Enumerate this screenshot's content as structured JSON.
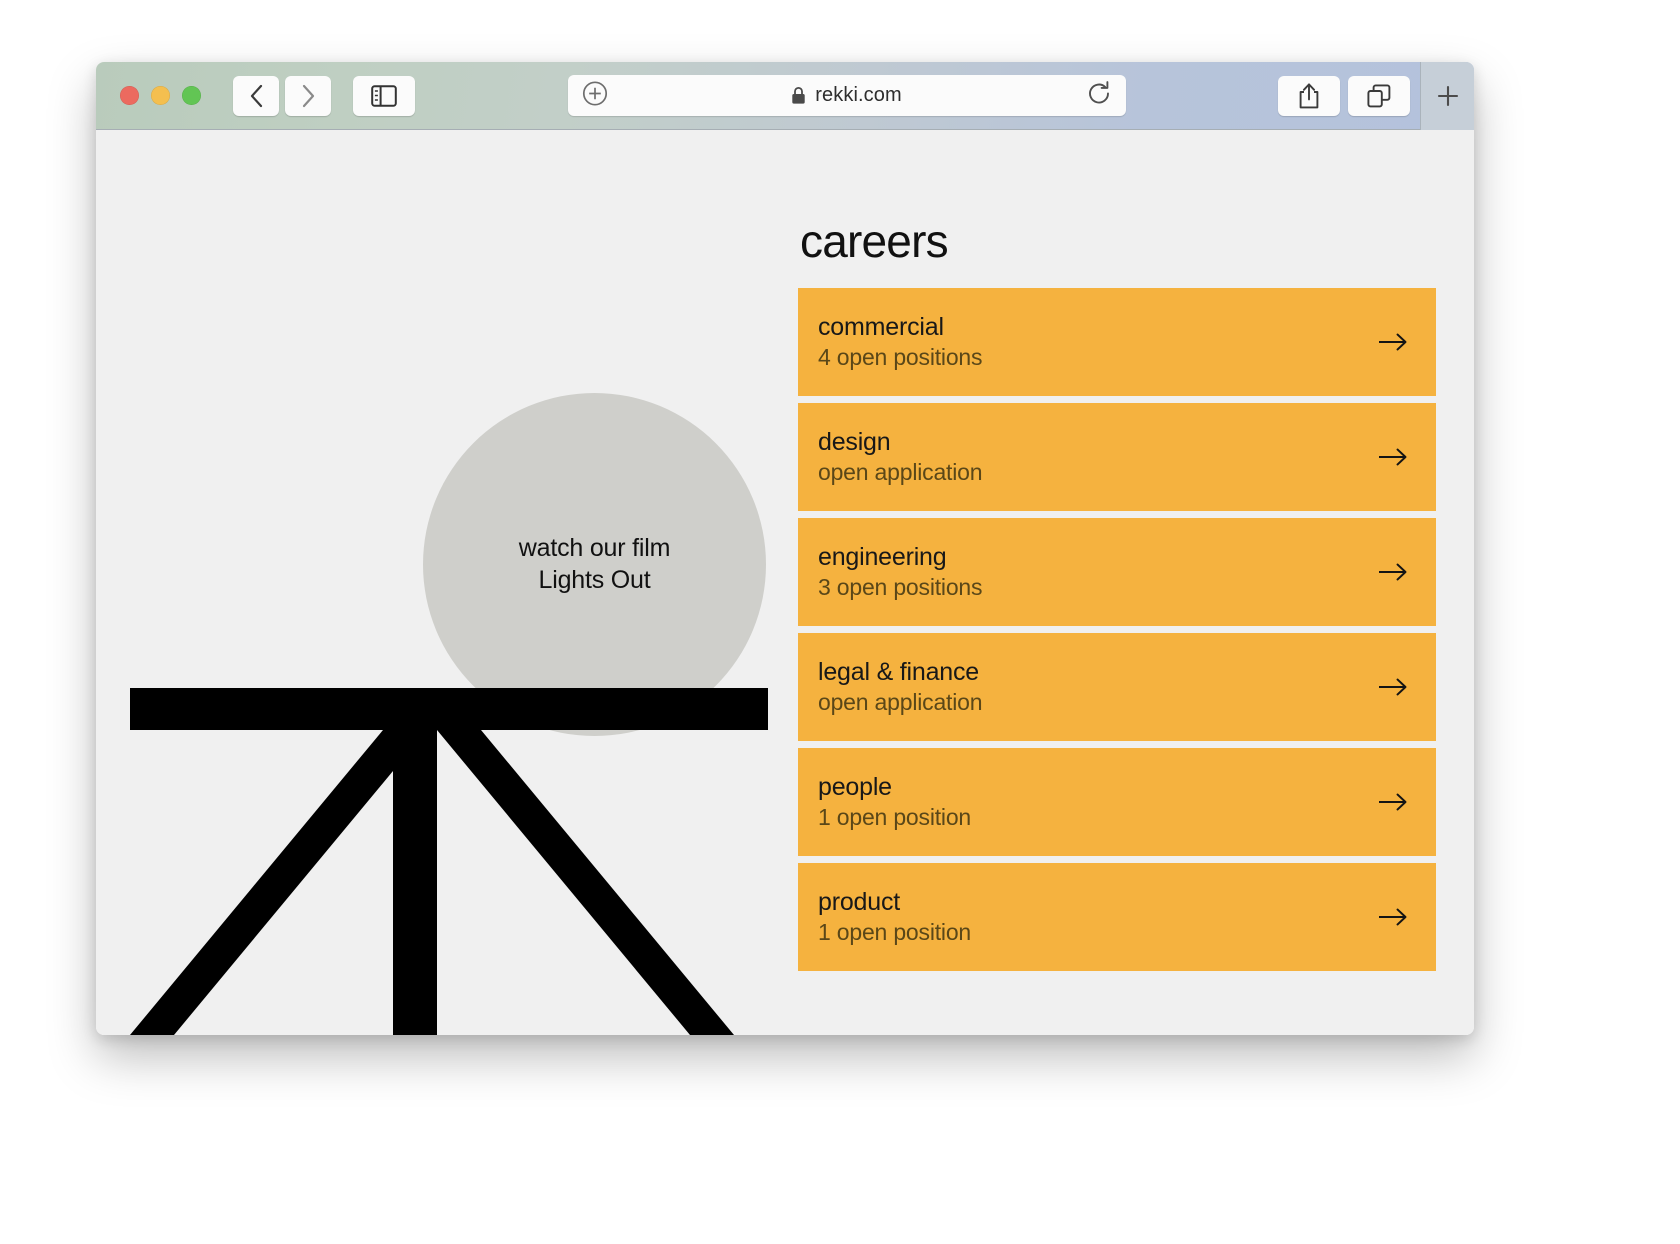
{
  "browser": {
    "traffic_lights": [
      "close",
      "minimize",
      "zoom"
    ],
    "back_label": "‹",
    "forward_label": "›",
    "sidebar_icon": "sidebar-icon",
    "plus_icon": "plus-circle-icon",
    "lock_icon": "lock-icon",
    "url": "rekki.com",
    "reload_icon": "reload-icon",
    "share_icon": "share-icon",
    "tabs_icon": "tabs-icon",
    "new_tab_label": "+",
    "colors": {
      "titlebar_left": "#b9cbbc",
      "titlebar_right": "#b4c2dc",
      "page_bg": "#f0f0f0"
    }
  },
  "page": {
    "film": {
      "line1": "watch our film",
      "line2": "Lights Out",
      "circle_color": "#cfcfcb"
    },
    "logo_name": "rekki-table-logo",
    "careers": {
      "heading": "careers",
      "card_color": "#f5b23f",
      "arrow_glyph": "→",
      "items": [
        {
          "title": "commercial",
          "subtitle": "4 open positions"
        },
        {
          "title": "design",
          "subtitle": "open application"
        },
        {
          "title": "engineering",
          "subtitle": "3 open positions"
        },
        {
          "title": "legal & finance",
          "subtitle": "open application"
        },
        {
          "title": "people",
          "subtitle": "1 open position"
        },
        {
          "title": "product",
          "subtitle": "1 open position"
        }
      ]
    }
  }
}
